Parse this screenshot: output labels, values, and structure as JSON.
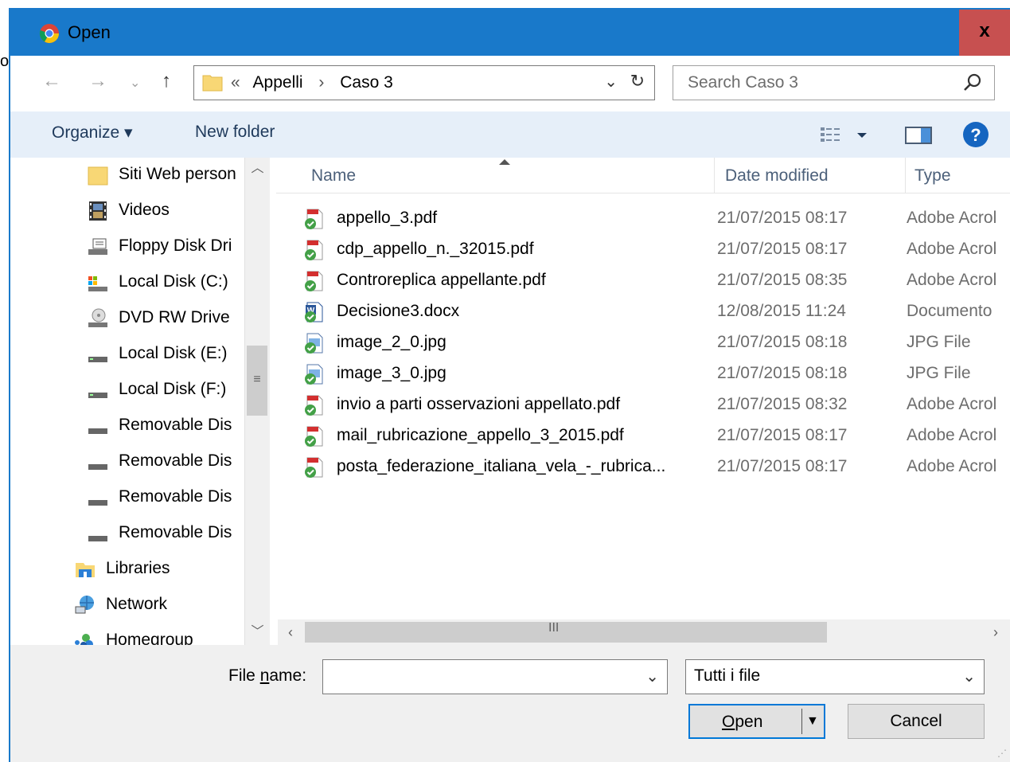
{
  "stray_char": "o",
  "window": {
    "title": "Open",
    "close_label": "x"
  },
  "address": {
    "overflow": "«",
    "crumbs": [
      "Appelli",
      "Caso 3"
    ],
    "separator": "›"
  },
  "search": {
    "placeholder": "Search Caso 3"
  },
  "toolbar": {
    "organize": "Organize ▾",
    "new_folder": "New folder"
  },
  "nav_items": [
    {
      "label": "Siti Web person",
      "icon": "folder-icon"
    },
    {
      "label": "Videos",
      "icon": "videos-icon"
    },
    {
      "label": "Floppy Disk Dri",
      "icon": "floppy-icon"
    },
    {
      "label": "Local Disk (C:)",
      "icon": "local-disk-c-icon"
    },
    {
      "label": "DVD RW Drive",
      "icon": "dvd-drive-icon"
    },
    {
      "label": "Local Disk (E:)",
      "icon": "drive-icon"
    },
    {
      "label": "Local Disk (F:)",
      "icon": "drive-icon"
    },
    {
      "label": "Removable Dis",
      "icon": "removable-drive-icon"
    },
    {
      "label": "Removable Dis",
      "icon": "removable-drive-icon"
    },
    {
      "label": "Removable Dis",
      "icon": "removable-drive-icon"
    },
    {
      "label": "Removable Dis",
      "icon": "removable-drive-icon"
    },
    {
      "label": "Libraries",
      "icon": "libraries-icon"
    },
    {
      "label": "Network",
      "icon": "network-icon"
    },
    {
      "label": "Homegroup",
      "icon": "homegroup-icon"
    }
  ],
  "columns": {
    "name": "Name",
    "date": "Date modified",
    "type": "Type"
  },
  "files": [
    {
      "name": "appello_3.pdf",
      "date": "21/07/2015 08:17",
      "type": "Adobe Acrol",
      "kind": "pdf"
    },
    {
      "name": "cdp_appello_n._32015.pdf",
      "date": "21/07/2015 08:17",
      "type": "Adobe Acrol",
      "kind": "pdf"
    },
    {
      "name": "Controreplica appellante.pdf",
      "date": "21/07/2015 08:35",
      "type": "Adobe Acrol",
      "kind": "pdf"
    },
    {
      "name": "Decisione3.docx",
      "date": "12/08/2015 11:24",
      "type": "Documento",
      "kind": "docx"
    },
    {
      "name": "image_2_0.jpg",
      "date": "21/07/2015 08:18",
      "type": "JPG File",
      "kind": "jpg"
    },
    {
      "name": "image_3_0.jpg",
      "date": "21/07/2015 08:18",
      "type": "JPG File",
      "kind": "jpg"
    },
    {
      "name": "invio a parti osservazioni appellato.pdf",
      "date": "21/07/2015 08:32",
      "type": "Adobe Acrol",
      "kind": "pdf"
    },
    {
      "name": "mail_rubricazione_appello_3_2015.pdf",
      "date": "21/07/2015 08:17",
      "type": "Adobe Acrol",
      "kind": "pdf"
    },
    {
      "name": "posta_federazione_italiana_vela_-_rubrica...",
      "date": "21/07/2015 08:17",
      "type": "Adobe Acrol",
      "kind": "pdf"
    }
  ],
  "footer": {
    "file_name_label_pre": "File ",
    "file_name_label_u": "n",
    "file_name_label_post": "ame:",
    "file_name_value": "",
    "file_type": "Tutti i file",
    "open_u": "O",
    "open_rest": "pen",
    "cancel": "Cancel"
  },
  "colors": {
    "titlebar": "#1979ca",
    "close": "#c75050",
    "toolbar": "#e6eff9",
    "link": "#1e395b"
  }
}
